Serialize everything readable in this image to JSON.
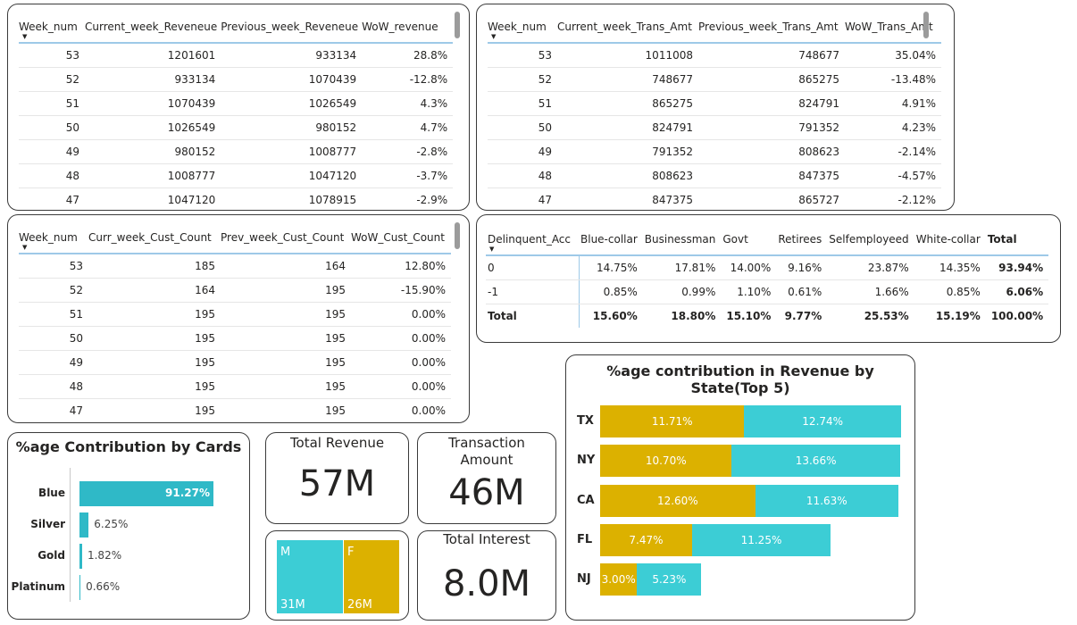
{
  "revenue_table": {
    "headers": [
      "Week_num",
      "Current_week_Reveneue",
      "Previous_week_Reveneue",
      "WoW_revenue"
    ],
    "rows": [
      [
        "53",
        "1201601",
        "933134",
        "28.8%"
      ],
      [
        "52",
        "933134",
        "1070439",
        "-12.8%"
      ],
      [
        "51",
        "1070439",
        "1026549",
        "4.3%"
      ],
      [
        "50",
        "1026549",
        "980152",
        "4.7%"
      ],
      [
        "49",
        "980152",
        "1008777",
        "-2.8%"
      ],
      [
        "48",
        "1008777",
        "1047120",
        "-3.7%"
      ],
      [
        "47",
        "1047120",
        "1078915",
        "-2.9%"
      ]
    ]
  },
  "trans_table": {
    "headers": [
      "Week_num",
      "Current_week_Trans_Amt",
      "Previous_week_Trans_Amt",
      "WoW_Trans_Amt"
    ],
    "rows": [
      [
        "53",
        "1011008",
        "748677",
        "35.04%"
      ],
      [
        "52",
        "748677",
        "865275",
        "-13.48%"
      ],
      [
        "51",
        "865275",
        "824791",
        "4.91%"
      ],
      [
        "50",
        "824791",
        "791352",
        "4.23%"
      ],
      [
        "49",
        "791352",
        "808623",
        "-2.14%"
      ],
      [
        "48",
        "808623",
        "847375",
        "-4.57%"
      ],
      [
        "47",
        "847375",
        "865727",
        "-2.12%"
      ]
    ]
  },
  "cust_table": {
    "headers": [
      "Week_num",
      "Curr_week_Cust_Count",
      "Prev_week_Cust_Count",
      "WoW_Cust_Count"
    ],
    "rows": [
      [
        "53",
        "185",
        "164",
        "12.80%"
      ],
      [
        "52",
        "164",
        "195",
        "-15.90%"
      ],
      [
        "51",
        "195",
        "195",
        "0.00%"
      ],
      [
        "50",
        "195",
        "195",
        "0.00%"
      ],
      [
        "49",
        "195",
        "195",
        "0.00%"
      ],
      [
        "48",
        "195",
        "195",
        "0.00%"
      ],
      [
        "47",
        "195",
        "195",
        "0.00%"
      ]
    ]
  },
  "matrix": {
    "headers": [
      "Delinquent_Acc",
      "Blue-collar",
      "Businessman",
      "Govt",
      "Retirees",
      "Selfemployeed",
      "White-collar",
      "Total"
    ],
    "rows": [
      [
        "0",
        "14.75%",
        "17.81%",
        "14.00%",
        "9.16%",
        "23.87%",
        "14.35%",
        "93.94%"
      ],
      [
        "-1",
        "0.85%",
        "0.99%",
        "1.10%",
        "0.61%",
        "1.66%",
        "0.85%",
        "6.06%"
      ],
      [
        "Total",
        "15.60%",
        "18.80%",
        "15.10%",
        "9.77%",
        "25.53%",
        "15.19%",
        "100.00%"
      ]
    ]
  },
  "cards_chart": {
    "title": "%age Contribution by Cards",
    "items": [
      {
        "label": "Blue",
        "value": 91.27,
        "text": "91.27%"
      },
      {
        "label": "Silver",
        "value": 6.25,
        "text": "6.25%"
      },
      {
        "label": "Gold",
        "value": 1.82,
        "text": "1.82%"
      },
      {
        "label": "Platinum",
        "value": 0.66,
        "text": "0.66%"
      }
    ],
    "color": "#2fb9c7"
  },
  "kpis": {
    "total_revenue": {
      "label": "Total Revenue",
      "value": "57M"
    },
    "transaction_amount": {
      "label": "Transaction Amount",
      "value": "46M"
    },
    "total_interest": {
      "label": "Total Interest",
      "value": "8.0M"
    }
  },
  "gender_treemap": {
    "items": [
      {
        "label": "M",
        "value_text": "31M",
        "value": 31,
        "color": "#3ccdd5"
      },
      {
        "label": "F",
        "value_text": "26M",
        "value": 26,
        "color": "#dcb100"
      }
    ]
  },
  "state_chart": {
    "title": "%age contribution in Revenue by State(Top 5)",
    "colors": [
      "#dcb100",
      "#3ccdd5"
    ],
    "states": [
      {
        "state": "TX",
        "a": 11.71,
        "a_text": "11.71%",
        "b": 12.74,
        "b_text": "12.74%"
      },
      {
        "state": "NY",
        "a": 10.7,
        "a_text": "10.70%",
        "b": 13.66,
        "b_text": "13.66%"
      },
      {
        "state": "CA",
        "a": 12.6,
        "a_text": "12.60%",
        "b": 11.63,
        "b_text": "11.63%"
      },
      {
        "state": "FL",
        "a": 7.47,
        "a_text": "7.47%",
        "b": 11.25,
        "b_text": "11.25%"
      },
      {
        "state": "NJ",
        "a": 3.0,
        "a_text": "3.00%",
        "b": 5.23,
        "b_text": "5.23%"
      }
    ]
  },
  "chart_data": [
    {
      "type": "bar",
      "title": "%age Contribution by Cards",
      "categories": [
        "Blue",
        "Silver",
        "Gold",
        "Platinum"
      ],
      "values": [
        91.27,
        6.25,
        1.82,
        0.66
      ],
      "orientation": "horizontal"
    },
    {
      "type": "bar",
      "title": "%age contribution in Revenue by State(Top 5)",
      "categories": [
        "TX",
        "NY",
        "CA",
        "FL",
        "NJ"
      ],
      "series": [
        {
          "values": [
            11.71,
            10.7,
            12.6,
            7.47,
            3.0
          ]
        },
        {
          "values": [
            12.74,
            13.66,
            11.63,
            11.25,
            5.23
          ]
        }
      ],
      "orientation": "horizontal",
      "stacked": true
    }
  ]
}
